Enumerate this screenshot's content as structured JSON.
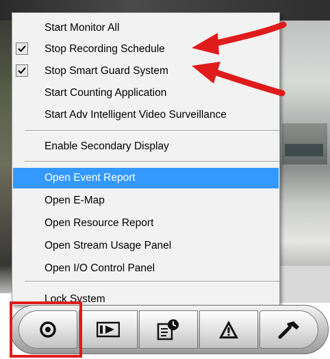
{
  "menu": {
    "items": [
      {
        "label": "Start Monitor All",
        "checked": false,
        "highlighted": false
      },
      {
        "label": "Stop Recording Schedule",
        "checked": true,
        "highlighted": false
      },
      {
        "label": "Stop Smart Guard System",
        "checked": true,
        "highlighted": false
      },
      {
        "label": "Start Counting Application",
        "checked": false,
        "highlighted": false
      },
      {
        "label": "Start Adv Intelligent Video Surveillance",
        "checked": false,
        "highlighted": false
      },
      {
        "label": "Enable Secondary Display",
        "checked": false,
        "highlighted": false
      },
      {
        "label": "Open Event Report",
        "checked": false,
        "highlighted": true
      },
      {
        "label": "Open E-Map",
        "checked": false,
        "highlighted": false
      },
      {
        "label": "Open Resource Report",
        "checked": false,
        "highlighted": false
      },
      {
        "label": "Open Stream Usage Panel",
        "checked": false,
        "highlighted": false
      },
      {
        "label": "Open I/O Control Panel",
        "checked": false,
        "highlighted": false
      },
      {
        "label": "Lock System",
        "checked": false,
        "highlighted": false
      }
    ]
  },
  "toolbar": {
    "buttons": [
      {
        "icon": "record-icon"
      },
      {
        "icon": "playback-icon"
      },
      {
        "icon": "schedule-icon"
      },
      {
        "icon": "alert-icon"
      },
      {
        "icon": "tools-icon"
      }
    ]
  },
  "colors": {
    "highlight": "#3399ff",
    "annotation_red": "#e01b1b"
  }
}
